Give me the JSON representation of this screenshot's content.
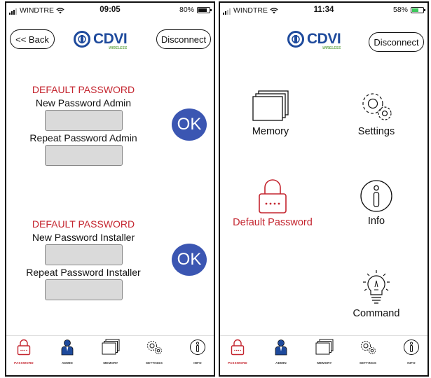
{
  "left_screen": {
    "status": {
      "carrier": "WINDTRE",
      "time": "09:05",
      "battery": "80%",
      "battery_level": 0.8
    },
    "header": {
      "back_label": "<< Back",
      "disconnect_label": "Disconnect",
      "brand": "CDVI",
      "brand_sub": "WIRELESS"
    },
    "admin_section": {
      "heading": "DEFAULT PASSWORD",
      "new_label": "New Password Admin",
      "new_value": "",
      "repeat_label": "Repeat Password Admin",
      "repeat_value": "",
      "ok_label": "OK"
    },
    "installer_section": {
      "heading": "DEFAULT PASSWORD",
      "new_label": "New Password Installer",
      "new_value": "",
      "repeat_label": "Repeat Password Installer",
      "repeat_value": "",
      "ok_label": "OK"
    }
  },
  "right_screen": {
    "status": {
      "carrier": "WINDTRE",
      "time": "11:34",
      "battery": "58%",
      "battery_level": 0.58
    },
    "header": {
      "disconnect_label": "Disconnect",
      "brand": "CDVI",
      "brand_sub": "WIRELESS"
    },
    "menu": {
      "memory": "Memory",
      "settings": "Settings",
      "default_password": "Default Password",
      "info": "Info",
      "command": "Command"
    }
  },
  "tabbar": {
    "items": [
      {
        "label": "PASSWORD",
        "icon": "padlock-icon"
      },
      {
        "label": "ADMIN",
        "icon": "person-icon"
      },
      {
        "label": "MEMORY",
        "icon": "stacked-cards-icon"
      },
      {
        "label": "SETTINGS",
        "icon": "gears-icon"
      },
      {
        "label": "INFO",
        "icon": "info-icon"
      }
    ],
    "active": "PASSWORD"
  },
  "colors": {
    "accent_red": "#c4252f",
    "brand_blue": "#1e4a9c",
    "ok_blue": "#3b56b2",
    "field_gray": "#dadada",
    "battery_green": "#3cc95c"
  }
}
